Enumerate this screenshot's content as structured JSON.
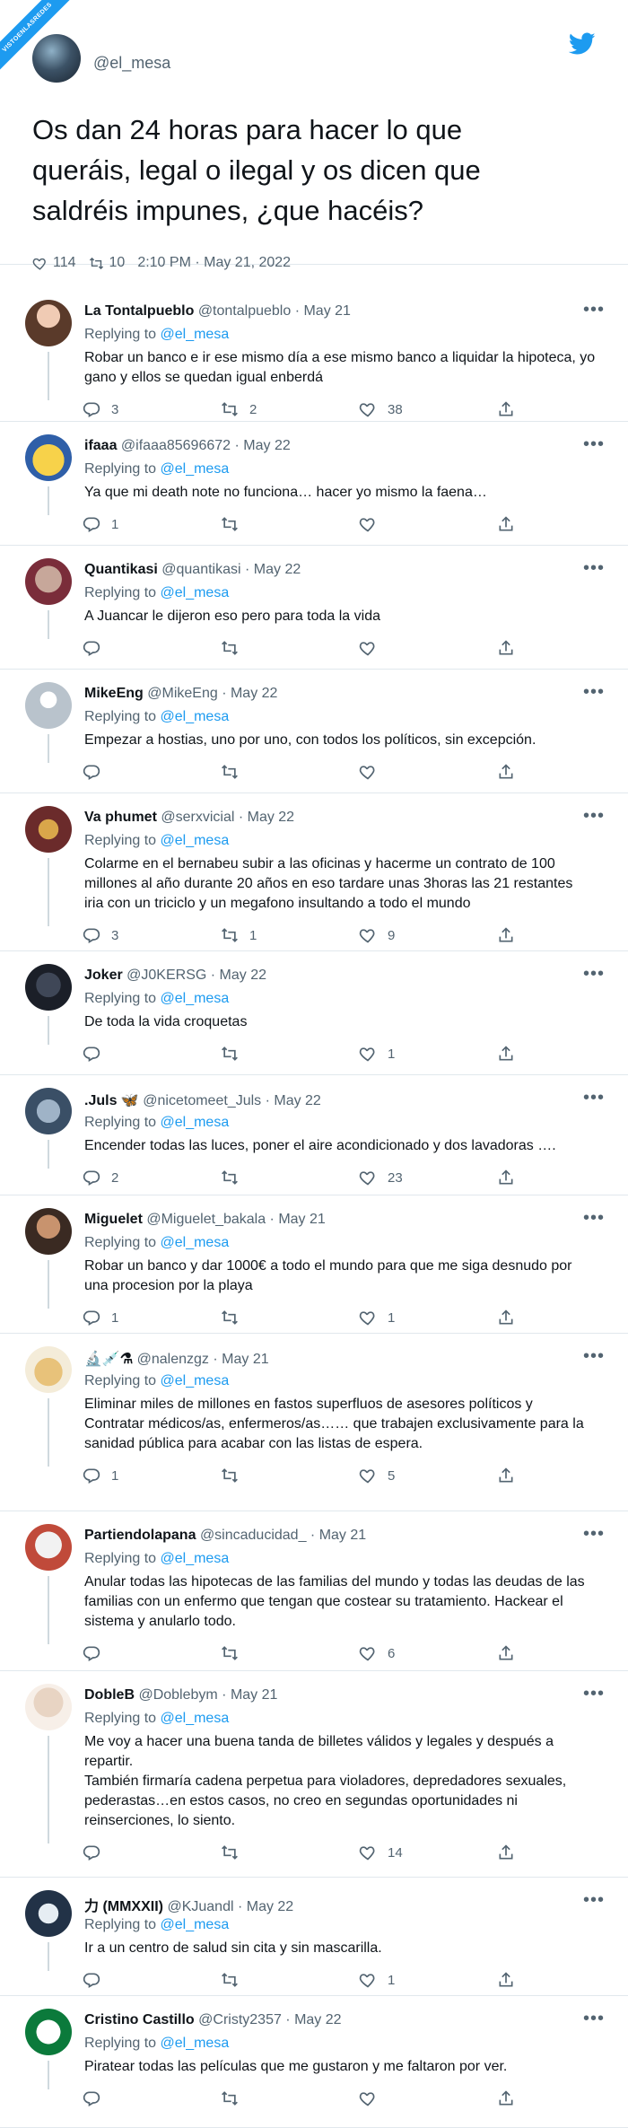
{
  "watermark": "VISTOENLASREDES",
  "main": {
    "handle": "@el_mesa",
    "text": "Os dan 24 horas para hacer lo que queráis, legal o ilegal y os dicen que saldréis impunes, ¿que hacéis?",
    "likes": "114",
    "retweets": "10",
    "timestamp": "2:10 PM · May 21, 2022"
  },
  "replying_prefix": "Replying to",
  "replying_handle": "@el_mesa",
  "replies": [
    {
      "name": "La Tontalpueblo",
      "handle": "@tontalpueblo",
      "date": "May 21",
      "text": "Robar un banco e ir ese mismo día a ese mismo banco a liquidar la hipoteca, yo gano y ellos se quedan igual enberdá",
      "replies": "3",
      "retweets": "2",
      "likes": "38"
    },
    {
      "name": "ifaaa",
      "handle": "@ifaaa85696672",
      "date": "May 22",
      "text": "Ya que mi death note no funciona… hacer yo mismo la faena…",
      "replies": "1",
      "retweets": "",
      "likes": ""
    },
    {
      "name": "Quantikasi",
      "handle": "@quantikasi",
      "date": "May 22",
      "text": "A Juancar le dijeron eso pero para toda la vida",
      "replies": "",
      "retweets": "",
      "likes": ""
    },
    {
      "name": "MikeEng",
      "handle": "@MikeEng",
      "date": "May 22",
      "text": "Empezar a hostias, uno por uno, con todos los políticos, sin excepción.",
      "replies": "",
      "retweets": "",
      "likes": ""
    },
    {
      "name": "Va phumet",
      "handle": "@serxvicial",
      "date": "May 22",
      "text": "Colarme en el bernabeu subir a las oficinas y hacerme un contrato de 100 millones al año durante 20 años en eso tardare unas 3horas las 21 restantes iria con un triciclo y un megafono insultando a todo el mundo",
      "replies": "3",
      "retweets": "1",
      "likes": "9"
    },
    {
      "name": "Joker",
      "handle": "@J0KERSG",
      "date": "May 22",
      "text": "De toda la vida croquetas",
      "replies": "",
      "retweets": "",
      "likes": "1"
    },
    {
      "name": ".Juls 🦋",
      "handle": "@nicetomeet_Juls",
      "date": "May 22",
      "text": "Encender todas las luces, poner el aire acondicionado y dos lavadoras ….",
      "replies": "2",
      "retweets": "",
      "likes": "23"
    },
    {
      "name": "Miguelet",
      "handle": "@Miguelet_bakala",
      "date": "May 21",
      "text": "Robar un banco y dar 1000€ a todo el mundo para que me siga desnudo por una procesion por la playa",
      "replies": "1",
      "retweets": "",
      "likes": "1"
    },
    {
      "name": "🔬💉⚗",
      "handle": "@nalenzgz",
      "date": "May 21",
      "text": "Eliminar miles de millones en fastos superfluos de asesores políticos y Contratar médicos/as, enfermeros/as…… que trabajen exclusivamente para la sanidad pública para acabar con las listas de espera.",
      "replies": "1",
      "retweets": "",
      "likes": "5"
    },
    {
      "name": "Partiendolapana",
      "handle": "@sincaducidad_",
      "date": "May 21",
      "text": "Anular todas las hipotecas de las familias del mundo y todas las deudas de las familias con un enfermo que tengan que costear su tratamiento. Hackear el sistema y anularlo todo.",
      "replies": "",
      "retweets": "",
      "likes": "6"
    },
    {
      "name": "DobleB",
      "handle": "@Doblebym",
      "date": "May 21",
      "text": "Me voy a hacer una buena tanda de billetes válidos y legales y después a repartir.\nTambién firmaría cadena perpetua para violadores, depredadores sexuales, pederastas…en estos casos, no creo en segundas oportunidades ni reinserciones, lo siento.",
      "replies": "",
      "retweets": "",
      "likes": "14"
    },
    {
      "name": "力 (MMXXII)",
      "handle": "@KJuandl",
      "date": "May 22",
      "text": "Ir a un centro de salud sin cita y sin mascarilla.",
      "replies": "",
      "retweets": "",
      "likes": "1"
    },
    {
      "name": "Cristino Castillo",
      "handle": "@Cristy2357",
      "date": "May 22",
      "text": "Piratear todas las películas que me gustaron y me faltaron por ver.",
      "replies": "",
      "retweets": "",
      "likes": ""
    }
  ],
  "colors": {
    "accent": "#1d9bf0",
    "text": "#0f1419",
    "muted": "#536471",
    "divider": "#e1e8ed"
  },
  "icons": [
    "twitter-bird-icon",
    "heart-icon",
    "retweet-icon",
    "reply-icon",
    "share-icon",
    "more-icon"
  ]
}
